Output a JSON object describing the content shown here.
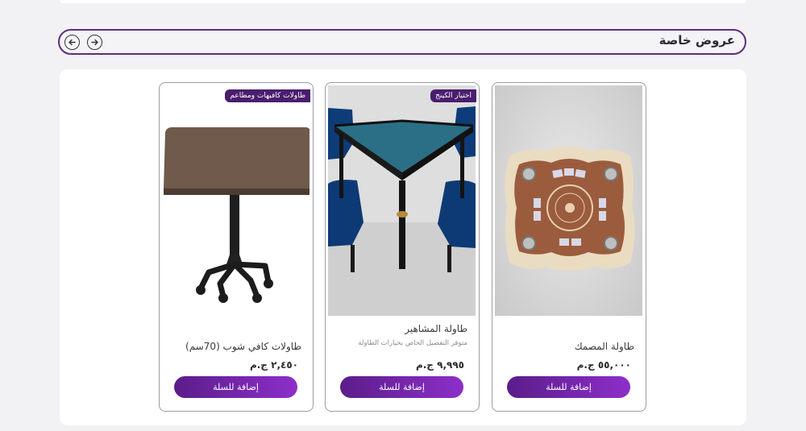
{
  "section": {
    "title": "عروض خاصة",
    "prev_icon": "arrow-left-icon",
    "next_icon": "arrow-right-icon"
  },
  "products": [
    {
      "name": "طاولة المصمك",
      "description": "",
      "price": "٥٥,٠٠٠ ج.م",
      "badge": "",
      "button": "إضافة للسلة"
    },
    {
      "name": "طاولة المشاهير",
      "description": "متوفر التفصيل الخاص بخيارات الطاولة",
      "price": "٩,٩٩٥ ج.م",
      "badge": "اختيار الكينج",
      "button": "إضافة للسلة"
    },
    {
      "name": "طاولات كافي شوب (70سم)",
      "description": "",
      "price": "٢,٤٥٠ ج.م",
      "badge": "طاولات كافيهات ومطاعم",
      "button": "إضافة للسلة"
    }
  ],
  "colors": {
    "accent": "#5b2d82",
    "button_start": "#5b1d8a",
    "button_end": "#8d2fc9",
    "badge": "#4a1d6e"
  }
}
